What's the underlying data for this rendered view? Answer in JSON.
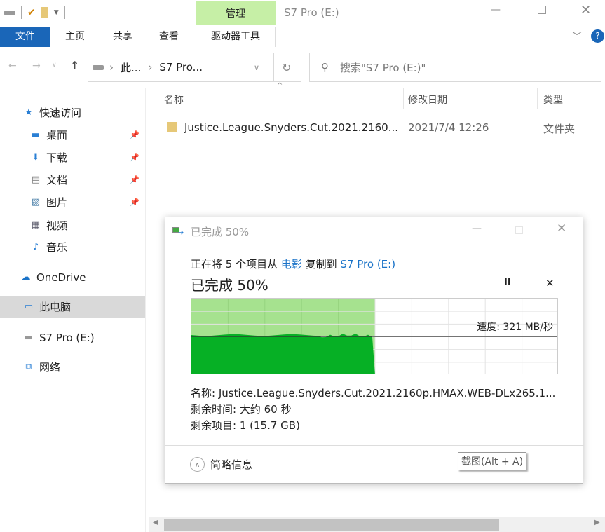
{
  "window": {
    "title": "S7 Pro (E:)",
    "context_tab": "管理",
    "context_color": "#c6efa6"
  },
  "ribbon": {
    "tabs": [
      "文件",
      "主页",
      "共享",
      "查看",
      "驱动器工具"
    ],
    "file_color": "#1a66b8"
  },
  "address": {
    "crumbs": [
      "此...",
      "S7 Pro..."
    ],
    "search_placeholder": "搜索\"S7 Pro (E:)\""
  },
  "columns": [
    "名称",
    "修改日期",
    "类型"
  ],
  "files": [
    {
      "name": "Justice.League.Snyders.Cut.2021.2160...",
      "date": "2021/7/4 12:26",
      "type": "文件夹"
    }
  ],
  "sidebar": {
    "items": [
      {
        "label": "快速访问",
        "icon": "star-icon"
      },
      {
        "label": "桌面",
        "icon": "desktop-icon",
        "pinned": true
      },
      {
        "label": "下载",
        "icon": "download-icon",
        "pinned": true
      },
      {
        "label": "文档",
        "icon": "document-icon",
        "pinned": true
      },
      {
        "label": "图片",
        "icon": "pictures-icon",
        "pinned": true
      },
      {
        "label": "视频",
        "icon": "video-icon"
      },
      {
        "label": "音乐",
        "icon": "music-icon"
      },
      {
        "label": "OneDrive",
        "icon": "cloud-icon"
      },
      {
        "label": "此电脑",
        "icon": "computer-icon",
        "selected": true
      },
      {
        "label": "S7 Pro (E:)",
        "icon": "drive-icon"
      },
      {
        "label": "网络",
        "icon": "network-icon"
      }
    ]
  },
  "dialog": {
    "title": "已完成 50%",
    "desc_pre": "正在将 5 个项目从 ",
    "from": "电影",
    "desc_mid": " 复制到 ",
    "to": "S7 Pro (E:)",
    "heading": "已完成 50%",
    "progress_percent": 50,
    "speed": "速度: 321 MB/秒",
    "name_line": "名称: Justice.League.Snyders.Cut.2021.2160p.HMAX.WEB-DLx265.1...",
    "time_line": "剩余时间: 大约 60 秒",
    "items_line": "剩余项目: 1 (15.7 GB)",
    "details_toggle": "简略信息",
    "tooltip": "截图(Alt + A)"
  }
}
